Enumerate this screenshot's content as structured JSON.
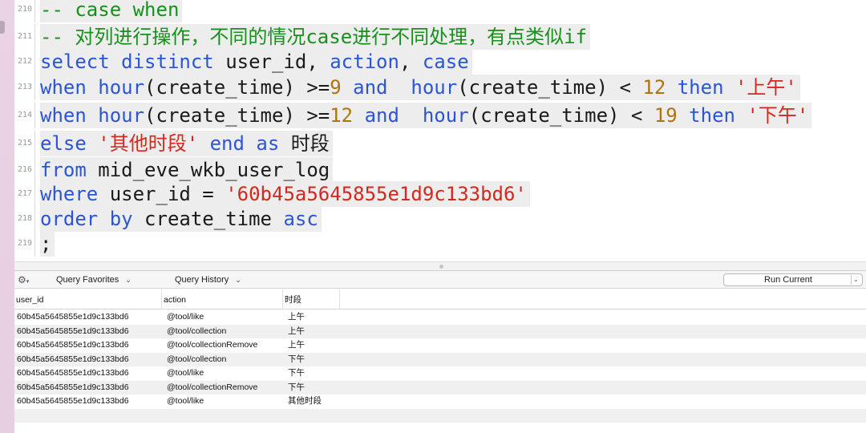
{
  "editor": {
    "lines": [
      {
        "no": "210",
        "tokens": [
          {
            "t": "-- case when",
            "c": "cm"
          }
        ]
      },
      {
        "no": "211",
        "tokens": [
          {
            "t": "-- 对列进行操作，不同的情况case进行不同处理，有点类似if",
            "c": "cm"
          }
        ]
      },
      {
        "no": "212",
        "tokens": [
          {
            "t": "select distinct ",
            "c": "kw"
          },
          {
            "t": "user_id, ",
            "c": "id"
          },
          {
            "t": "action",
            "c": "kw"
          },
          {
            "t": ", ",
            "c": "id"
          },
          {
            "t": "case",
            "c": "kw"
          }
        ]
      },
      {
        "no": "213",
        "tokens": [
          {
            "t": "when ",
            "c": "kw"
          },
          {
            "t": "hour",
            "c": "kw"
          },
          {
            "t": "(create_time) >=",
            "c": "id"
          },
          {
            "t": "9",
            "c": "num"
          },
          {
            "t": " and  ",
            "c": "kw"
          },
          {
            "t": "hour",
            "c": "kw"
          },
          {
            "t": "(create_time) < ",
            "c": "id"
          },
          {
            "t": "12",
            "c": "num"
          },
          {
            "t": " then ",
            "c": "kw"
          },
          {
            "t": "'上午'",
            "c": "str"
          }
        ]
      },
      {
        "no": "214",
        "tokens": [
          {
            "t": "when ",
            "c": "kw"
          },
          {
            "t": "hour",
            "c": "kw"
          },
          {
            "t": "(create_time) >=",
            "c": "id"
          },
          {
            "t": "12",
            "c": "num"
          },
          {
            "t": " and  ",
            "c": "kw"
          },
          {
            "t": "hour",
            "c": "kw"
          },
          {
            "t": "(create_time) < ",
            "c": "id"
          },
          {
            "t": "19",
            "c": "num"
          },
          {
            "t": " then ",
            "c": "kw"
          },
          {
            "t": "'下午'",
            "c": "str"
          }
        ]
      },
      {
        "no": "215",
        "tokens": [
          {
            "t": "else ",
            "c": "kw"
          },
          {
            "t": "'其他时段'",
            "c": "str"
          },
          {
            "t": " end as ",
            "c": "kw"
          },
          {
            "t": "时段",
            "c": "id"
          }
        ]
      },
      {
        "no": "216",
        "tokens": [
          {
            "t": "from ",
            "c": "kw"
          },
          {
            "t": "mid_eve_wkb_user_log",
            "c": "id"
          }
        ]
      },
      {
        "no": "217",
        "tokens": [
          {
            "t": "where ",
            "c": "kw"
          },
          {
            "t": "user_id = ",
            "c": "id"
          },
          {
            "t": "'60b45a5645855e1d9c133bd6'",
            "c": "str"
          }
        ]
      },
      {
        "no": "218",
        "tokens": [
          {
            "t": "order by ",
            "c": "kw"
          },
          {
            "t": "create_time ",
            "c": "id"
          },
          {
            "t": "asc",
            "c": "kw"
          }
        ]
      },
      {
        "no": "219",
        "tokens": [
          {
            "t": ";",
            "c": "id"
          }
        ]
      }
    ]
  },
  "toolbar": {
    "gear_icon": "gear-icon",
    "favorites_label": "Query Favorites",
    "history_label": "Query History",
    "chevron": "⌄",
    "run_label": "Run Current",
    "run_arrow": "⌄"
  },
  "results": {
    "columns": [
      "user_id",
      "action",
      "时段"
    ],
    "rows": [
      [
        "60b45a5645855e1d9c133bd6",
        "@tool/like",
        "上午"
      ],
      [
        "60b45a5645855e1d9c133bd6",
        "@tool/collection",
        "上午"
      ],
      [
        "60b45a5645855e1d9c133bd6",
        "@tool/collectionRemove",
        "上午"
      ],
      [
        "60b45a5645855e1d9c133bd6",
        "@tool/collection",
        "下午"
      ],
      [
        "60b45a5645855e1d9c133bd6",
        "@tool/like",
        "下午"
      ],
      [
        "60b45a5645855e1d9c133bd6",
        "@tool/collectionRemove",
        "下午"
      ],
      [
        "60b45a5645855e1d9c133bd6",
        "@tool/like",
        "其他时段"
      ]
    ]
  },
  "colors": {
    "comment": "#16911a",
    "keyword": "#2b55d6",
    "number": "#b0730c",
    "string": "#d3281f"
  }
}
